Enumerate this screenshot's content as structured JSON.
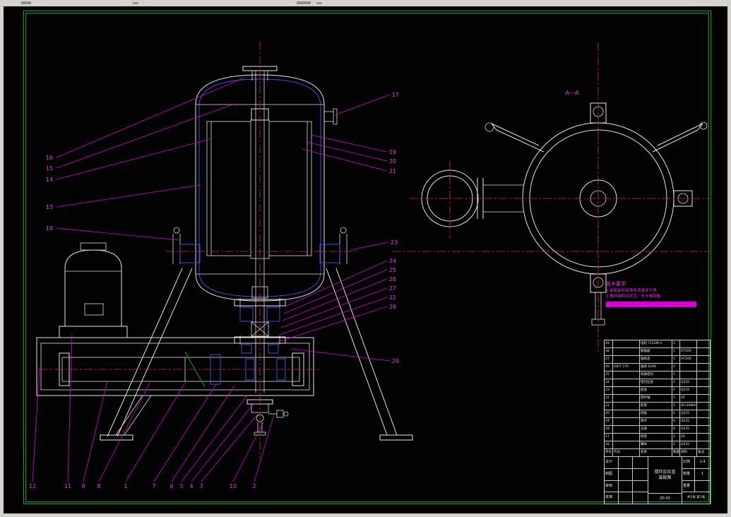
{
  "view_label": "A—A",
  "tech_notes": {
    "lines": [
      "技术要求",
      "1.装配前所有零件须清洗干净;",
      "2.搅拌轴转动灵活、无卡滞现象;"
    ]
  },
  "callouts": {
    "left": [
      "16",
      "15",
      "14",
      "13",
      "18"
    ],
    "right": [
      "17",
      "19",
      "20",
      "21",
      "23",
      "24",
      "25",
      "26",
      "27",
      "22",
      "28",
      "29"
    ],
    "bottom": [
      "12",
      "11",
      "9",
      "8",
      "1",
      "7",
      "6",
      "5",
      "4",
      "3",
      "10",
      "2"
    ]
  },
  "bom": {
    "header": [
      "序号",
      "代号",
      "名称",
      "数量",
      "材料",
      "备注"
    ],
    "rows": [
      [
        "29",
        "",
        "电机 Y112M-4",
        "1",
        "",
        ""
      ],
      [
        "28",
        "",
        "联轴器",
        "1",
        "HT200",
        ""
      ],
      [
        "27",
        "",
        "轴承盖",
        "1",
        "HT200",
        ""
      ],
      [
        "26",
        "GB/T 276",
        "轴承 6208",
        "2",
        "",
        ""
      ],
      [
        "25",
        "",
        "机械密封",
        "1",
        "",
        ""
      ],
      [
        "24",
        "",
        "密封压盖",
        "1",
        "Q235",
        ""
      ],
      [
        "23",
        "",
        "底盖",
        "1",
        "Q235",
        ""
      ],
      [
        "22",
        "",
        "搅拌轴",
        "1",
        "45",
        ""
      ],
      [
        "21",
        "",
        "蛇管",
        "1",
        "0Cr18Ni9",
        ""
      ],
      [
        "20",
        "",
        "挡板",
        "4",
        "Q235",
        ""
      ],
      [
        "19",
        "",
        "桨叶",
        "6",
        "Q235",
        ""
      ],
      [
        "18",
        "",
        "支座",
        "4",
        "Q235",
        ""
      ],
      [
        "17",
        "",
        "接管",
        "1",
        "20",
        ""
      ],
      [
        "16",
        "",
        "罐体",
        "1",
        "Q235",
        ""
      ]
    ]
  },
  "titleblock": {
    "left_labels": [
      "设计",
      "制图",
      "审核",
      "批准"
    ],
    "title": "搅拌反应釜",
    "subtitle": "装配图",
    "number": "ZP-00",
    "scale_label": "比例",
    "scale": "1:4",
    "qty_label": "数量",
    "qty": "1",
    "mass_label": "重量",
    "mass": "",
    "sheet": "共1张 第1张"
  }
}
